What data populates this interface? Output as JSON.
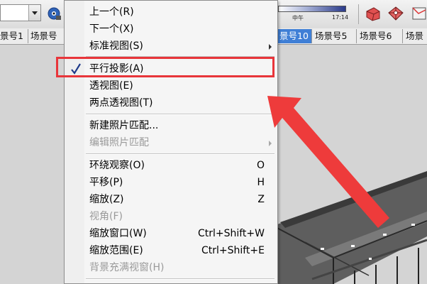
{
  "toolbar": {
    "icons": [
      "style-dropdown",
      "eye-icon",
      "shadow-settings-icon",
      "section-plane-icon",
      "section-fill-icon"
    ],
    "shadow": {
      "noon_label": "中午",
      "time_label": "17:14"
    }
  },
  "scene_tabs": [
    {
      "label": "景号1",
      "active": false
    },
    {
      "label": "场景号",
      "active": false
    },
    {
      "label": "景号10",
      "active": true
    },
    {
      "label": "场景号5",
      "active": false
    },
    {
      "label": "场景号6",
      "active": false
    },
    {
      "label": "场景",
      "active": false
    }
  ],
  "menu": {
    "items": [
      {
        "label": "上一个(R)",
        "shortcut": "",
        "submenu": false,
        "disabled": false,
        "checked": false
      },
      {
        "label": "下一个(X)",
        "shortcut": "",
        "submenu": false,
        "disabled": false,
        "checked": false
      },
      {
        "label": "标准视图(S)",
        "shortcut": "",
        "submenu": true,
        "disabled": false,
        "checked": false
      },
      {
        "label": "平行投影(A)",
        "shortcut": "",
        "submenu": false,
        "disabled": false,
        "checked": true
      },
      {
        "label": "透视图(E)",
        "shortcut": "",
        "submenu": false,
        "disabled": false,
        "checked": false
      },
      {
        "label": "两点透视图(T)",
        "shortcut": "",
        "submenu": false,
        "disabled": false,
        "checked": false
      },
      {
        "label": "新建照片匹配...",
        "shortcut": "",
        "submenu": false,
        "disabled": false,
        "checked": false
      },
      {
        "label": "编辑照片匹配",
        "shortcut": "",
        "submenu": true,
        "disabled": true,
        "checked": false
      },
      {
        "label": "环绕观察(O)",
        "shortcut": "O",
        "submenu": false,
        "disabled": false,
        "checked": false
      },
      {
        "label": "平移(P)",
        "shortcut": "H",
        "submenu": false,
        "disabled": false,
        "checked": false
      },
      {
        "label": "缩放(Z)",
        "shortcut": "Z",
        "submenu": false,
        "disabled": false,
        "checked": false
      },
      {
        "label": "视角(F)",
        "shortcut": "",
        "submenu": false,
        "disabled": true,
        "checked": false
      },
      {
        "label": "缩放窗口(W)",
        "shortcut": "Ctrl+Shift+W",
        "submenu": false,
        "disabled": false,
        "checked": false
      },
      {
        "label": "缩放范围(E)",
        "shortcut": "Ctrl+Shift+E",
        "submenu": false,
        "disabled": false,
        "checked": false
      },
      {
        "label": "背景充满视窗(H)",
        "shortcut": "",
        "submenu": false,
        "disabled": true,
        "checked": false
      }
    ]
  },
  "colors": {
    "highlight": "#e8353a",
    "active_tab": "#3f7fd6",
    "check": "#1e3a8a"
  }
}
